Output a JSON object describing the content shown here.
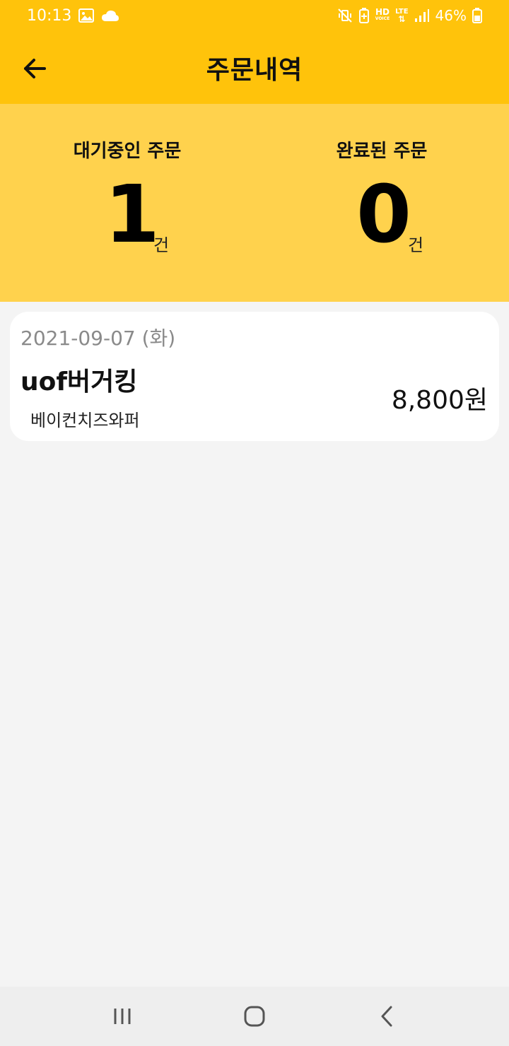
{
  "status_bar": {
    "time": "10:13",
    "battery": "46%",
    "network_hd": "HD",
    "network_voice": "VOICE",
    "network_lte": "LTE",
    "icons": [
      "image-icon",
      "cloud-icon",
      "vibrate-mute-icon",
      "battery-saver-icon",
      "signal-icon",
      "battery-icon"
    ]
  },
  "header": {
    "title": "주문내역",
    "back_icon": "arrow-left-icon"
  },
  "summary": {
    "pending": {
      "label": "대기중인 주문",
      "count": "1",
      "unit": "건"
    },
    "completed": {
      "label": "완료된 주문",
      "count": "0",
      "unit": "건"
    }
  },
  "orders": [
    {
      "date": "2021-09-07 (화)",
      "store": "uof버거킹",
      "item": "베이컨치즈와퍼",
      "price": "8,800원"
    }
  ],
  "nav_bar": {
    "icons": [
      "recent-apps-icon",
      "home-icon",
      "back-icon"
    ]
  },
  "colors": {
    "header_bg": "#ffc30b",
    "summary_bg": "#ffd24d",
    "page_bg": "#f4f4f4",
    "card_bg": "#ffffff"
  }
}
